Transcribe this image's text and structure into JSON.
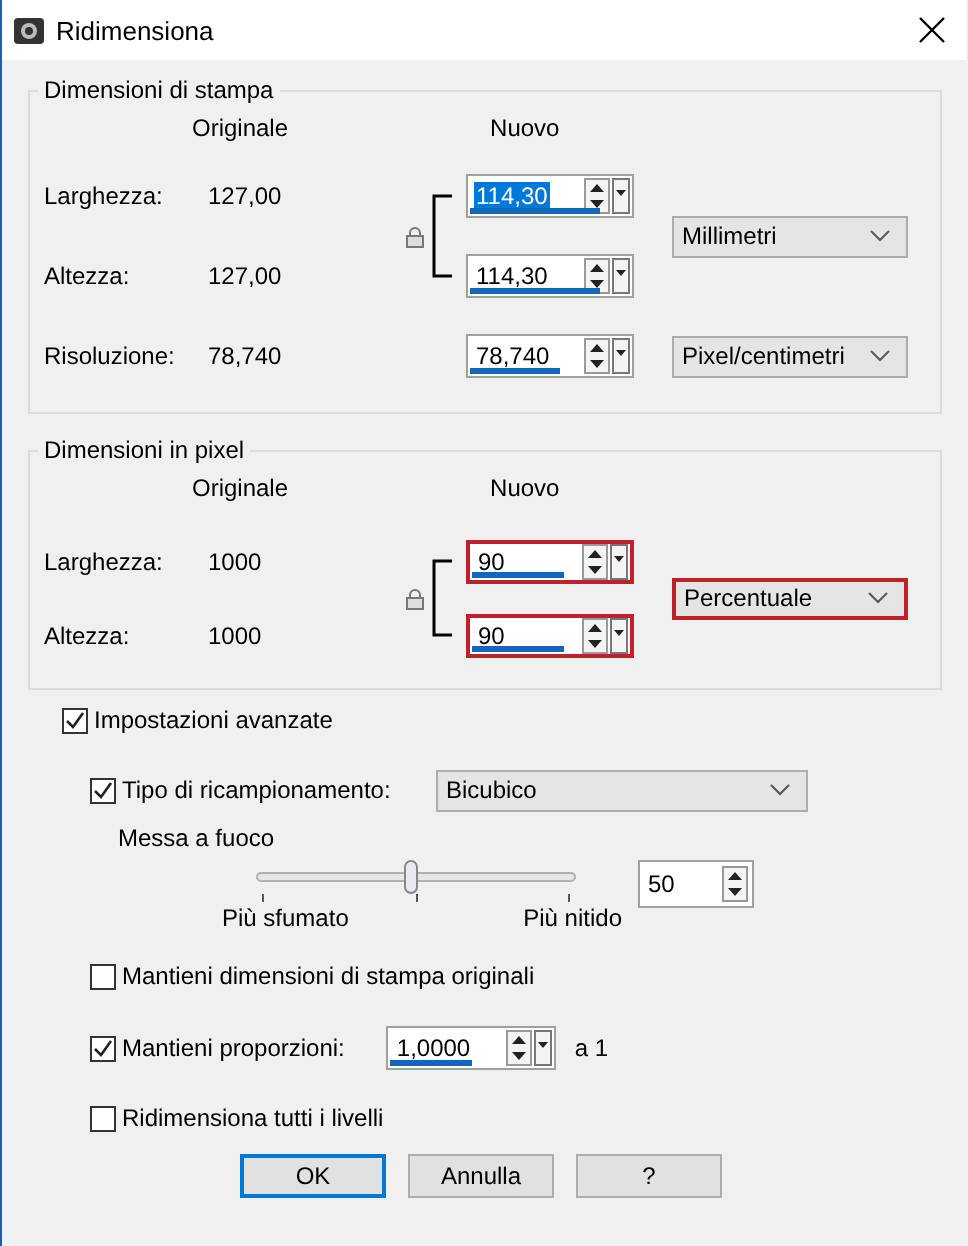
{
  "window": {
    "title": "Ridimensiona"
  },
  "print_size": {
    "title": "Dimensioni di stampa",
    "header_original": "Originale",
    "header_new": "Nuovo",
    "rows": [
      {
        "label": "Larghezza:",
        "original": "127,00",
        "value": "114,30",
        "level": 0.79,
        "highlighted": false,
        "text_selected": true
      },
      {
        "label": "Altezza:",
        "original": "127,00",
        "value": "114,30",
        "level": 0.79,
        "highlighted": false,
        "text_selected": false
      },
      {
        "label": "Risoluzione:",
        "original": "78,740",
        "value": "78,740",
        "level": 0.55,
        "highlighted": false,
        "text_selected": false
      }
    ],
    "size_unit": {
      "value": "Millimetri",
      "highlighted": false
    },
    "resolution_unit": {
      "value": "Pixel/centimetri",
      "highlighted": false
    }
  },
  "pixel_size": {
    "title": "Dimensioni in pixel",
    "header_original": "Originale",
    "header_new": "Nuovo",
    "rows": [
      {
        "label": "Larghezza:",
        "original": "1000",
        "value": "90",
        "level": 0.58,
        "highlighted": true,
        "text_selected": false
      },
      {
        "label": "Altezza:",
        "original": "1000",
        "value": "90",
        "level": 0.58,
        "highlighted": true,
        "text_selected": false
      }
    ],
    "unit": {
      "value": "Percentuale",
      "highlighted": true
    }
  },
  "advanced": {
    "label": "Impostazioni avanzate",
    "checked": true
  },
  "resample": {
    "label": "Tipo di ricampionamento:",
    "checked": true,
    "method": "Bicubico"
  },
  "sharpness": {
    "label": "Messa a fuoco",
    "level": 0.49,
    "min_label": "Più sfumato",
    "max_label": "Più nitido",
    "value": "50"
  },
  "options": [
    {
      "kind": "checkbox",
      "label": "Mantieni dimensioni di stampa originali",
      "checked": false
    },
    {
      "kind": "ratio",
      "label": "Mantieni proporzioni:",
      "checked": true,
      "value": "1,0000",
      "level": 0.49,
      "suffix": "a 1"
    },
    {
      "kind": "checkbox",
      "label": "Ridimensiona tutti i livelli",
      "checked": false
    }
  ],
  "buttons": [
    {
      "label": "OK",
      "default": true
    },
    {
      "label": "Annulla",
      "default": false
    },
    {
      "label": "?",
      "default": false
    }
  ]
}
